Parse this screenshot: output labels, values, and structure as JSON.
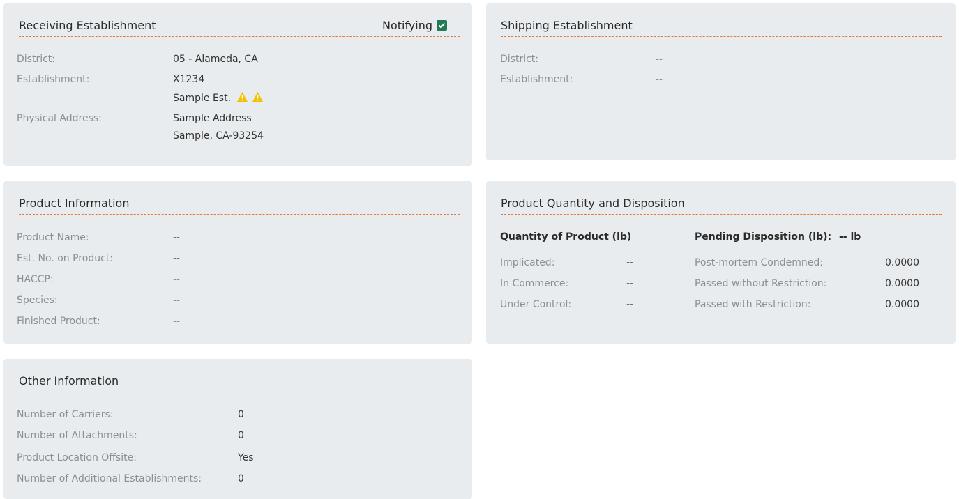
{
  "receiving": {
    "title": "Receiving Establishment",
    "notifying_label": "Notifying",
    "notifying_checked": true,
    "district_label": "District:",
    "district_value": "05 - Alameda, CA",
    "establishment_label": "Establishment:",
    "establishment_id": "X1234",
    "establishment_name": "Sample Est.",
    "address_label": "Physical Address:",
    "address_line1": "Sample Address",
    "address_line2": "Sample, CA-93254"
  },
  "shipping": {
    "title": "Shipping Establishment",
    "district_label": "District:",
    "district_value": "--",
    "establishment_label": "Establishment:",
    "establishment_value": "--"
  },
  "product_info": {
    "title": "Product Information",
    "rows": [
      {
        "label": "Product Name:",
        "value": "--"
      },
      {
        "label": "Est. No. on Product:",
        "value": "--"
      },
      {
        "label": "HACCP:",
        "value": "--"
      },
      {
        "label": "Species:",
        "value": "--"
      },
      {
        "label": "Finished Product:",
        "value": "--"
      }
    ]
  },
  "quantity": {
    "title": "Product Quantity and Disposition",
    "left_header": "Quantity of Product (lb)",
    "right_header": "Pending Disposition (lb):",
    "right_header_value": "-- lb",
    "left_rows": [
      {
        "label": "Implicated:",
        "value": "--"
      },
      {
        "label": "In Commerce:",
        "value": "--"
      },
      {
        "label": "Under Control:",
        "value": "--"
      }
    ],
    "right_rows": [
      {
        "label": "Post-mortem Condemned:",
        "value": "0.0000"
      },
      {
        "label": "Passed without Restriction:",
        "value": "0.0000"
      },
      {
        "label": "Passed with Restriction:",
        "value": "0.0000"
      }
    ]
  },
  "other": {
    "title": "Other Information",
    "rows": [
      {
        "label": "Number of Carriers:",
        "value": "0"
      },
      {
        "label": "Number of Attachments:",
        "value": "0"
      },
      {
        "label": "Product Location Offsite:",
        "value": "Yes"
      },
      {
        "label": "Number of Additional Establishments:",
        "value": "0"
      }
    ]
  },
  "colors": {
    "card_bg": "#e9ecee",
    "divider": "#e07a3a",
    "checkbox": "#1f7a55",
    "warning": "#f2c200"
  },
  "icons": [
    "check-icon",
    "warning-icon"
  ]
}
